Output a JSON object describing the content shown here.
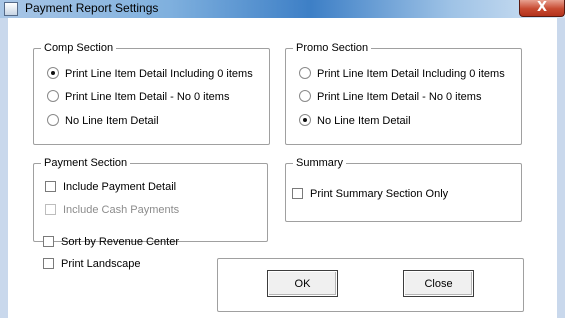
{
  "window": {
    "title": "Payment Report Settings",
    "close_glyph": "X"
  },
  "comp_section": {
    "title": "Comp Section",
    "options": [
      {
        "label": "Print Line Item Detail  Including 0 items",
        "selected": true
      },
      {
        "label": "Print Line Item Detail - No 0 items",
        "selected": false
      },
      {
        "label": "No Line Item Detail",
        "selected": false
      }
    ]
  },
  "promo_section": {
    "title": "Promo Section",
    "options": [
      {
        "label": "Print Line Item Detail  Including 0 items",
        "selected": false
      },
      {
        "label": "Print Line Item Detail - No 0 items",
        "selected": false
      },
      {
        "label": "No Line Item Detail",
        "selected": true
      }
    ]
  },
  "payment_section": {
    "title": "Payment Section",
    "include_payment_detail": {
      "label": "Include Payment Detail",
      "checked": false,
      "enabled": true
    },
    "include_cash_payments": {
      "label": "Include Cash Payments",
      "checked": false,
      "enabled": false
    }
  },
  "summary": {
    "title": "Summary",
    "print_summary_only": {
      "label": "Print Summary Section Only",
      "checked": false
    }
  },
  "options": {
    "sort_by_revenue_center": {
      "label": "Sort by Revenue Center",
      "checked": false
    },
    "print_landscape": {
      "label": "Print Landscape",
      "checked": false
    }
  },
  "buttons": {
    "ok": "OK",
    "close": "Close"
  }
}
